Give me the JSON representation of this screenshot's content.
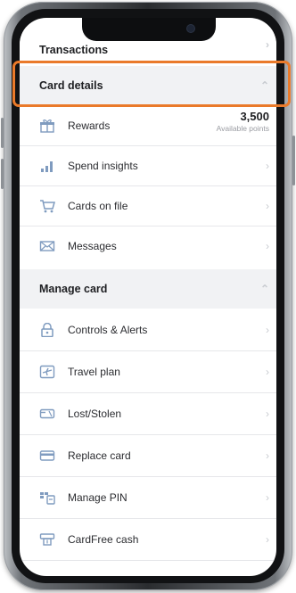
{
  "sections": {
    "transactions": "Transactions",
    "card_details": "Card details",
    "manage_card": "Manage card"
  },
  "card_details_items": [
    {
      "label": "Rewards",
      "icon": "gift-icon"
    },
    {
      "label": "Spend insights",
      "icon": "bar-chart-icon"
    },
    {
      "label": "Cards on file",
      "icon": "shopping-cart-icon"
    },
    {
      "label": "Messages",
      "icon": "envelope-icon"
    }
  ],
  "rewards": {
    "points": "3,500",
    "points_label": "Available points"
  },
  "manage_card_items": [
    {
      "label": "Controls & Alerts",
      "icon": "lock-icon"
    },
    {
      "label": "Travel plan",
      "icon": "plane-icon"
    },
    {
      "label": "Lost/Stolen",
      "icon": "lost-card-icon"
    },
    {
      "label": "Replace card",
      "icon": "card-icon"
    },
    {
      "label": "Manage PIN",
      "icon": "pin-keypad-icon"
    },
    {
      "label": "CardFree cash",
      "icon": "atm-icon"
    }
  ],
  "colors": {
    "highlight": "#ea7a2a",
    "icon": "#7f9bbf"
  }
}
